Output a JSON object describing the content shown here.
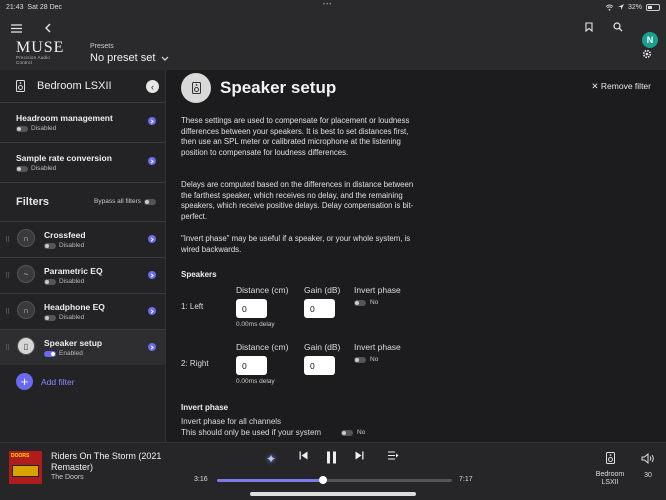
{
  "status": {
    "time": "21:43",
    "date": "Sat 28 Dec",
    "battery": "32%",
    "dots": "•••"
  },
  "header": {
    "logo_main": "MUSE",
    "logo_sub": "Precision Audio Control",
    "presets_label": "Presets",
    "presets_value": "No preset set",
    "avatar_initial": "N"
  },
  "sidebar": {
    "device_name": "Bedroom LSXII",
    "settings": [
      {
        "title": "Headroom management",
        "status": "Disabled"
      },
      {
        "title": "Sample rate conversion",
        "status": "Disabled"
      }
    ],
    "filters_title": "Filters",
    "bypass_label": "Bypass all filters",
    "filters": [
      {
        "title": "Crossfeed",
        "status": "Disabled"
      },
      {
        "title": "Parametric EQ",
        "status": "Disabled"
      },
      {
        "title": "Headphone EQ",
        "status": "Disabled"
      },
      {
        "title": "Speaker setup",
        "status": "Enabled"
      }
    ],
    "add_filter": "Add filter"
  },
  "main": {
    "title": "Speaker setup",
    "remove_filter": "Remove filter",
    "para1": "These settings are used to compensate for placement or loudness differences between your speakers. It is best to set distances first, then use an SPL meter or calibrated microphone at the listening position to compensate for loudness differences.",
    "para2": "Delays are computed based on the differences in distance between the farthest speaker, which receives no delay, and the remaining speakers, which receive positive delays. Delay compensation is bit-perfect.",
    "para3": "\"Invert phase\" may be useful if a speaker, or your whole system, is wired backwards.",
    "speakers_title": "Speakers",
    "speakers": [
      {
        "label": "1: Left",
        "distance_head": "Distance (cm)",
        "gain_head": "Gain (dB)",
        "invert_head": "Invert phase",
        "distance": "0",
        "gain": "0",
        "delay": "0.00ms delay",
        "invert": "No"
      },
      {
        "label": "2: Right",
        "distance_head": "Distance (cm)",
        "gain_head": "Gain (dB)",
        "invert_head": "Invert phase",
        "distance": "0",
        "gain": "0",
        "delay": "0.00ms delay",
        "invert": "No"
      }
    ],
    "invert_title": "Invert phase",
    "invert_all_label": "Invert phase for all channels",
    "invert_all_note": "This should only be used if your system",
    "invert_all_value": "No"
  },
  "player": {
    "album_text": "DOORS",
    "track": "Riders On The Storm (2021 Remaster)",
    "artist": "The Doors",
    "elapsed": "3:16",
    "total": "7:17",
    "progress": 0.45,
    "zone": "Bedroom LSXII",
    "volume": "30"
  },
  "colors": {
    "accent": "#6a6af0",
    "avatar": "#1aa08f",
    "background": "#1c1c1e"
  }
}
